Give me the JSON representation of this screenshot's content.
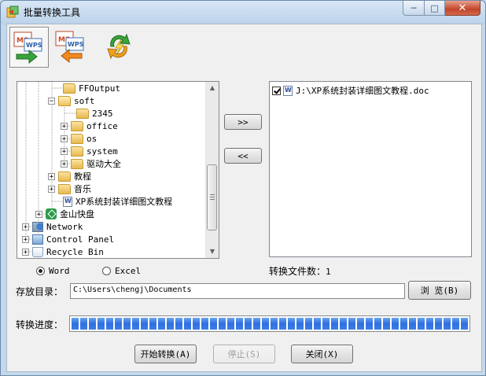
{
  "window": {
    "title": "批量转换工具",
    "controls": {
      "minimize": "─",
      "maximize": "□",
      "close": "✕"
    }
  },
  "toolbar": {
    "buttons": [
      {
        "icon": "ms-to-wps-icon",
        "label_top": "MS",
        "label_bottom": "WPS",
        "selected": true
      },
      {
        "icon": "wps-to-ms-icon",
        "label_top": "MS",
        "label_bottom": "WPS",
        "selected": false
      },
      {
        "icon": "refresh-convert-icon",
        "selected": false
      }
    ]
  },
  "tree": {
    "rows": [
      {
        "label": "FFOutput",
        "icon": "folder",
        "expander": ""
      },
      {
        "label": "soft",
        "icon": "folder-open",
        "expander": "−"
      },
      {
        "label": "2345",
        "icon": "folder",
        "expander": ""
      },
      {
        "label": "office",
        "icon": "folder",
        "expander": "+"
      },
      {
        "label": "os",
        "icon": "folder",
        "expander": "+"
      },
      {
        "label": "system",
        "icon": "folder",
        "expander": "+"
      },
      {
        "label": "驱动大全",
        "icon": "folder",
        "expander": "+"
      },
      {
        "label": "教程",
        "icon": "folder",
        "expander": "+"
      },
      {
        "label": "音乐",
        "icon": "folder",
        "expander": "+"
      },
      {
        "label": "XP系统封装详细图文教程",
        "icon": "word-doc",
        "expander": ""
      },
      {
        "label": "金山快盘",
        "icon": "kuaipan-drive",
        "expander": "+"
      },
      {
        "label": "Network",
        "icon": "network",
        "expander": "+"
      },
      {
        "label": "Control Panel",
        "icon": "control-panel",
        "expander": "+"
      },
      {
        "label": "Recycle Bin",
        "icon": "recycle-bin",
        "expander": "+"
      }
    ]
  },
  "transfer": {
    "add_label": ">>",
    "remove_label": "<<"
  },
  "filelist": {
    "items": [
      {
        "checked": true,
        "label": "J:\\XP系统封装详细图文教程.doc"
      }
    ]
  },
  "format": {
    "word_label": "Word",
    "excel_label": "Excel",
    "selected": "Word"
  },
  "count": {
    "label": "转换文件数：",
    "value": "1"
  },
  "save": {
    "label": "存放目录：",
    "path": "C:\\Users\\chengj\\Documents",
    "browse_label": "浏 览(B)"
  },
  "progress": {
    "label": "转换进度：",
    "fraction": 1.0
  },
  "actions": {
    "start_label": "开始转换(A)",
    "stop_label": "停止(S)",
    "close_label": "关闭(X)"
  }
}
